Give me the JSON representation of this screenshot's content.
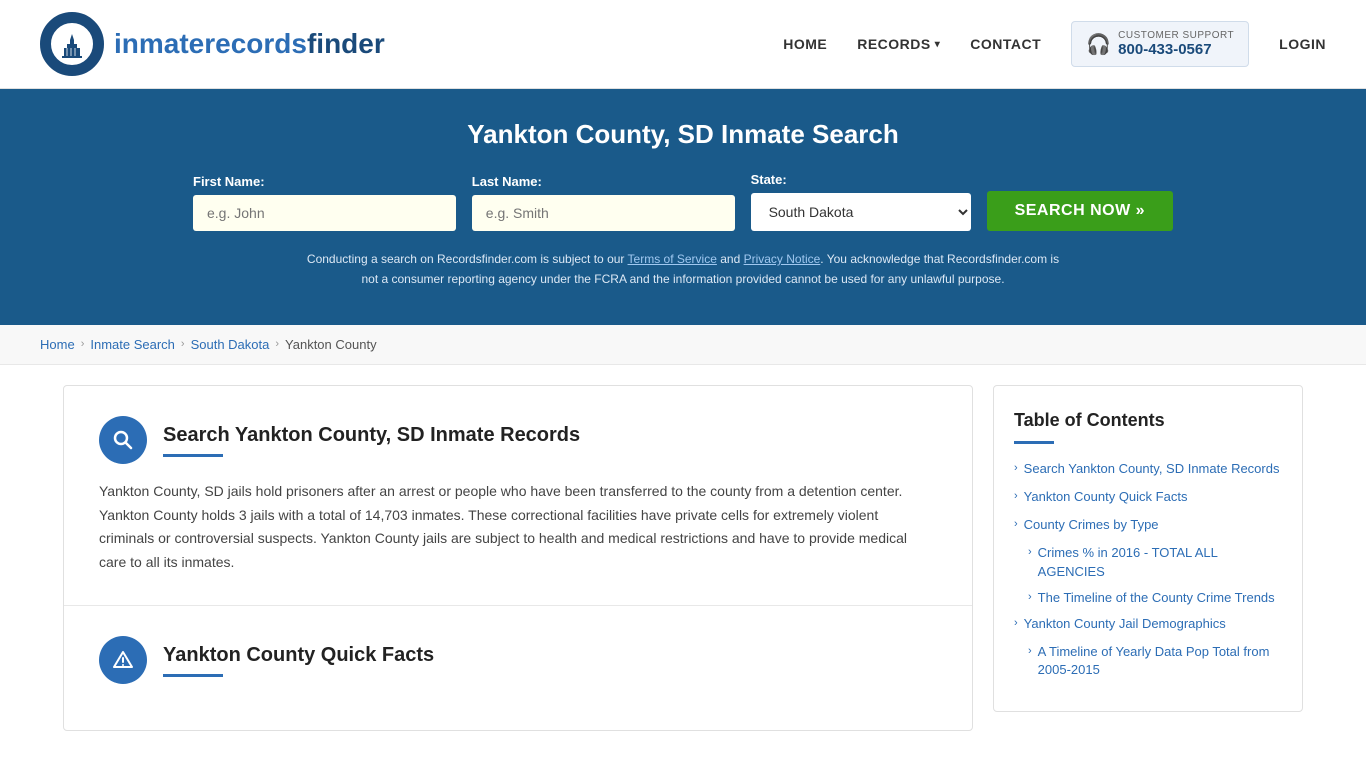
{
  "header": {
    "logo_text_part1": "inmaterecords",
    "logo_text_part2": "finder",
    "nav": {
      "home": "HOME",
      "records": "RECORDS",
      "contact": "CONTACT",
      "login": "LOGIN"
    },
    "support": {
      "label": "CUSTOMER SUPPORT",
      "number": "800-433-0567"
    }
  },
  "hero": {
    "title": "Yankton County, SD Inmate Search",
    "form": {
      "first_name_label": "First Name:",
      "first_name_placeholder": "e.g. John",
      "last_name_label": "Last Name:",
      "last_name_placeholder": "e.g. Smith",
      "state_label": "State:",
      "state_value": "South Dakota",
      "search_button": "SEARCH NOW »"
    },
    "disclaimer": "Conducting a search on Recordsfinder.com is subject to our Terms of Service and Privacy Notice. You acknowledge that Recordsfinder.com is not a consumer reporting agency under the FCRA and the information provided cannot be used for any unlawful purpose."
  },
  "breadcrumb": {
    "home": "Home",
    "inmate_search": "Inmate Search",
    "south_dakota": "South Dakota",
    "current": "Yankton County"
  },
  "article": {
    "section1": {
      "title": "Search Yankton County, SD Inmate Records",
      "body": "Yankton County, SD jails hold prisoners after an arrest or people who have been transferred to the county from a detention center. Yankton County holds 3 jails with a total of 14,703 inmates. These correctional facilities have private cells for extremely violent criminals or controversial suspects. Yankton County jails are subject to health and medical restrictions and have to provide medical care to all its inmates."
    },
    "section2": {
      "title": "Yankton County Quick Facts"
    }
  },
  "toc": {
    "title": "Table of Contents",
    "items": [
      {
        "label": "Search Yankton County, SD Inmate Records",
        "indent": false
      },
      {
        "label": "Yankton County Quick Facts",
        "indent": false
      },
      {
        "label": "County Crimes by Type",
        "indent": false
      },
      {
        "label": "Crimes % in 2016 - TOTAL ALL AGENCIES",
        "indent": true
      },
      {
        "label": "The Timeline of the County Crime Trends",
        "indent": true
      },
      {
        "label": "Yankton County Jail Demographics",
        "indent": false
      },
      {
        "label": "A Timeline of Yearly Data Pop Total from 2005-2015",
        "indent": true
      }
    ]
  }
}
